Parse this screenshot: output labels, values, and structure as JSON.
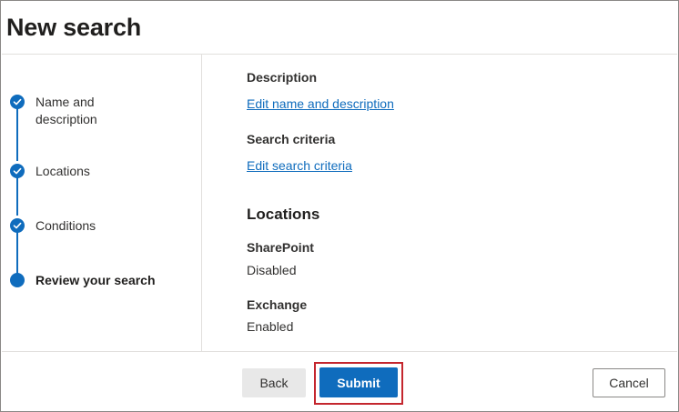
{
  "title": "New search",
  "steps": [
    {
      "label_line1": "Name and",
      "label_line2": "description",
      "state": "completed"
    },
    {
      "label": "Locations",
      "state": "completed"
    },
    {
      "label": "Conditions",
      "state": "completed"
    },
    {
      "label": "Review your search",
      "state": "current"
    }
  ],
  "review": {
    "description_label": "Description",
    "description_link": "Edit name and description",
    "criteria_label": "Search criteria",
    "criteria_link": "Edit search criteria",
    "locations_heading": "Locations",
    "sharepoint_label": "SharePoint",
    "sharepoint_value": "Disabled",
    "exchange_label": "Exchange",
    "exchange_value": "Enabled"
  },
  "footer": {
    "back_label": "Back",
    "submit_label": "Submit",
    "cancel_label": "Cancel"
  },
  "colors": {
    "accent": "#0f6cbd",
    "highlight_box": "#c4262e"
  },
  "icons": {
    "completed_step": "checkmark-icon",
    "current_step": "filled-circle-icon"
  }
}
